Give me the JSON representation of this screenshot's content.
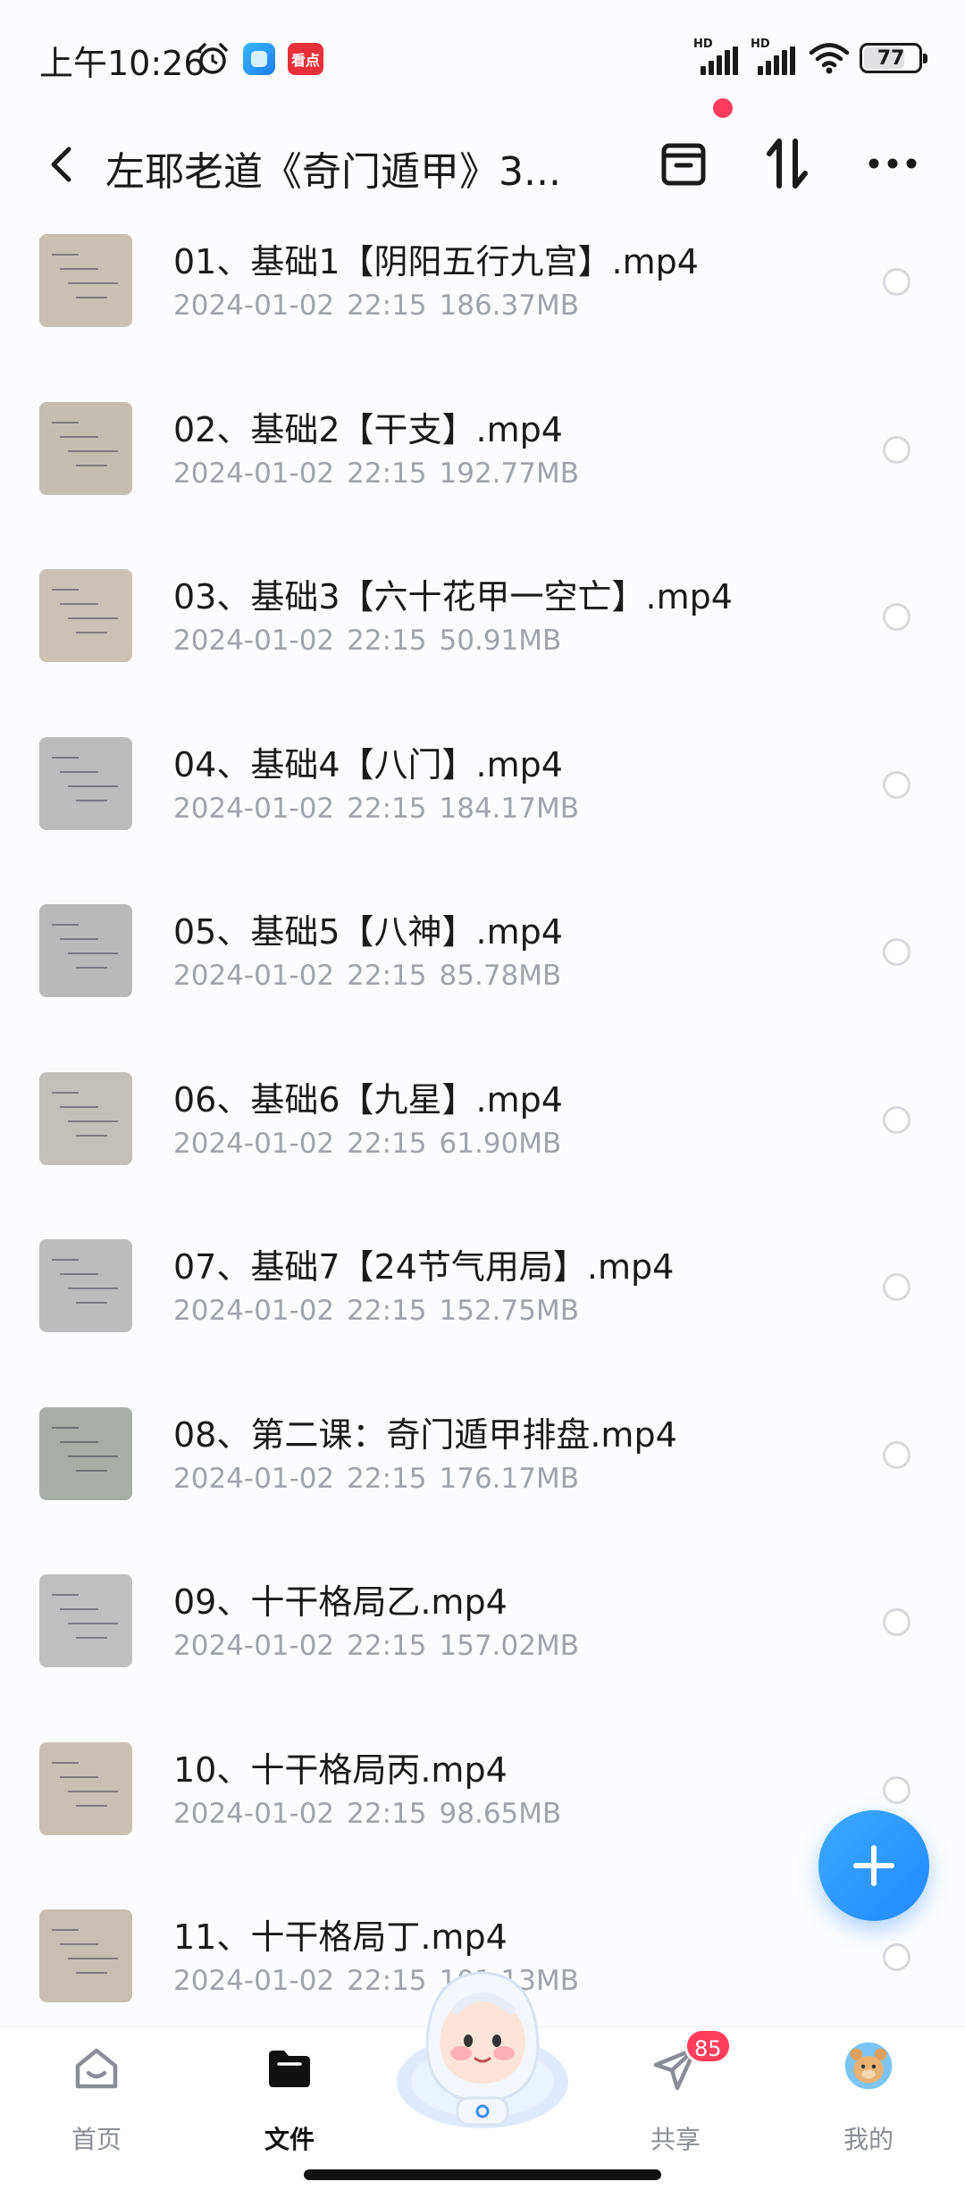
{
  "status_bar": {
    "time": "上午10:26",
    "app_badge_red": "看点",
    "battery": "77",
    "battery_level": 0.77,
    "signal_label_1": "HD",
    "signal_label_2": "HD"
  },
  "header": {
    "title": "左耶老道《奇门遁甲》3...",
    "back_icon": "chevron-left-icon",
    "icons": [
      "archive-box-icon",
      "sort-icon",
      "more-icon"
    ]
  },
  "files": [
    {
      "name": "01、基础1【阴阳五行九宫】.mp4",
      "date": "2024-01-02",
      "time": "22:15",
      "size": "186.37MB"
    },
    {
      "name": "02、基础2【干支】.mp4",
      "date": "2024-01-02",
      "time": "22:15",
      "size": "192.77MB"
    },
    {
      "name": "03、基础3【六十花甲一空亡】.mp4",
      "date": "2024-01-02",
      "time": "22:15",
      "size": "50.91MB"
    },
    {
      "name": "04、基础4【八门】.mp4",
      "date": "2024-01-02",
      "time": "22:15",
      "size": "184.17MB"
    },
    {
      "name": "05、基础5【八神】.mp4",
      "date": "2024-01-02",
      "time": "22:15",
      "size": "85.78MB"
    },
    {
      "name": "06、基础6【九星】.mp4",
      "date": "2024-01-02",
      "time": "22:15",
      "size": "61.90MB"
    },
    {
      "name": "07、基础7【24节气用局】.mp4",
      "date": "2024-01-02",
      "time": "22:15",
      "size": "152.75MB"
    },
    {
      "name": "08、第二课：奇门遁甲排盘.mp4",
      "date": "2024-01-02",
      "time": "22:15",
      "size": "176.17MB"
    },
    {
      "name": "09、十干格局乙.mp4",
      "date": "2024-01-02",
      "time": "22:15",
      "size": "157.02MB"
    },
    {
      "name": "10、十干格局丙.mp4",
      "date": "2024-01-02",
      "time": "22:15",
      "size": "98.65MB"
    },
    {
      "name": "11、十干格局丁.mp4",
      "date": "2024-01-02",
      "time": "22:15",
      "size": "101.13MB"
    }
  ],
  "fab": {
    "icon": "plus-icon"
  },
  "bottom_nav": {
    "items": [
      {
        "label": "首页",
        "icon": "home-icon",
        "active": false
      },
      {
        "label": "文件",
        "icon": "folder-icon",
        "active": true
      },
      {
        "label": "共享",
        "icon": "send-icon",
        "active": false,
        "badge": "85"
      },
      {
        "label": "我的",
        "icon": "avatar-icon",
        "active": false
      }
    ]
  },
  "colors": {
    "accent": "#2389ff",
    "badge": "#ff3e5c",
    "meta_text": "#a0a3ab",
    "background": "#fcfcfe"
  }
}
